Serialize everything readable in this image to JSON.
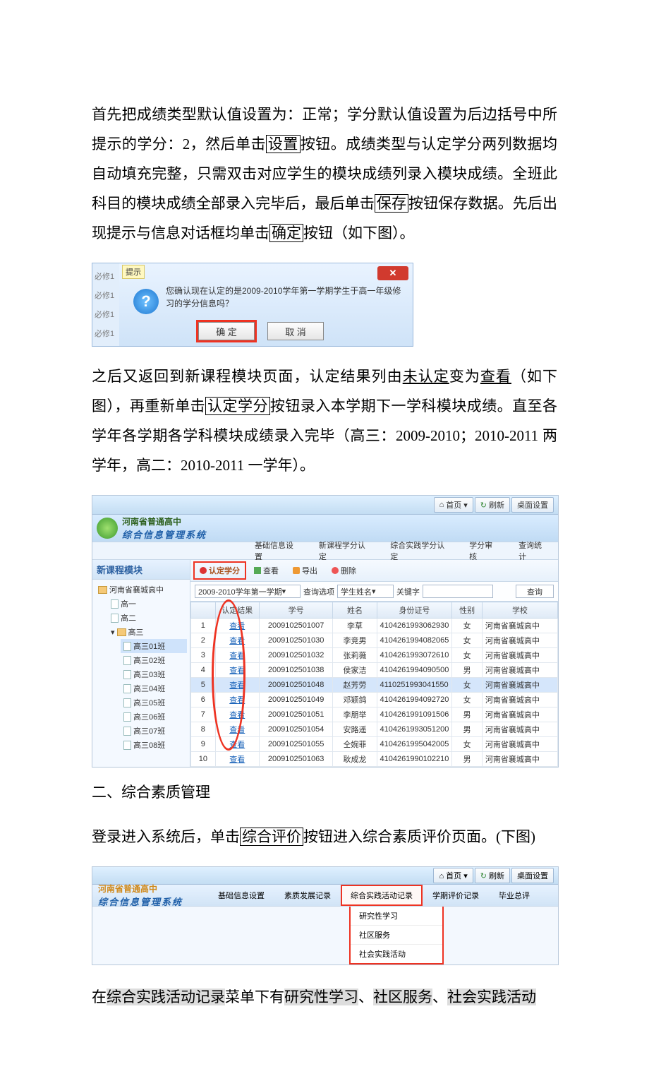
{
  "para1": {
    "a": "首先把成绩类型默认值设置为：正常；学分默认值设置为后边括号中所提示的学分：2，然后单击",
    "b": "设置",
    "c": "按钮。成绩类型与认定学分两列数据均自动填充完整，只需双击对应学生的模块成绩列录入模块成绩。全班此科目的模块成绩全部录入完毕后，最后单击",
    "d": "保存",
    "e": "按钮保存数据。先后出现提示与信息对话框均单击",
    "f": "确定",
    "g": "按钮（如下图）。"
  },
  "dialog": {
    "leftItems": [
      "必修1",
      "必修1",
      "必修1",
      "必修1"
    ],
    "tip": "提示",
    "close": "✕",
    "msg": "您确认现在认定的是2009-2010学年第一学期学生于高一年级修习的学分信息吗？",
    "ok": "确 定",
    "cancel": "取 消"
  },
  "para2": {
    "a": "之后又返回到新课程模块页面，认定结果列由",
    "b": "未认定",
    "c": "变为",
    "d": "查看",
    "e": "（如下图），再重新单击",
    "f": "认定学分",
    "g": "按钮录入本学期下一学科模块成绩。直至各学年各学期各学科模块成绩录入完毕（高三：2009-2010；2010-2011 两学年，高二：2010-2011 一学年）。"
  },
  "shot2": {
    "top": {
      "home": "首页",
      "refresh": "刷新",
      "desk": "桌面设置"
    },
    "brand": {
      "t1": "河南省普通高中",
      "t2": "综合信息管理系统"
    },
    "menu": [
      "基础信息设置",
      "新课程学分认定",
      "综合实践学分认定",
      "学分审核",
      "查询统计"
    ],
    "sideTitle": "新课程模块",
    "tree": {
      "root": "河南省襄城高中",
      "g1": "高一",
      "g2": "高二",
      "g3": "高三",
      "classes": [
        "高三01班",
        "高三02班",
        "高三03班",
        "高三04班",
        "高三05班",
        "高三06班",
        "高三07班",
        "高三08班"
      ]
    },
    "toolbar": {
      "rd": "认定学分",
      "view": "查看",
      "export": "导出",
      "del": "删除"
    },
    "filter": {
      "term": "2009-2010学年第一学期",
      "opt": "查询选项",
      "nameSel": "学生姓名",
      "kw": "关键字",
      "search": "查询"
    },
    "cols": [
      "",
      "认定结果",
      "学号",
      "姓名",
      "身份证号",
      "性别",
      "学校"
    ],
    "look": "查看",
    "rows": [
      {
        "n": "1",
        "id": "2009102501007",
        "name": "李草",
        "idno": "4104261993062930",
        "sex": "女",
        "sch": "河南省襄城高中"
      },
      {
        "n": "2",
        "id": "2009102501030",
        "name": "李竞男",
        "idno": "4104261994082065",
        "sex": "女",
        "sch": "河南省襄城高中"
      },
      {
        "n": "3",
        "id": "2009102501032",
        "name": "张莉薇",
        "idno": "4104261993072610",
        "sex": "女",
        "sch": "河南省襄城高中"
      },
      {
        "n": "4",
        "id": "2009102501038",
        "name": "侯家洁",
        "idno": "4104261994090500",
        "sex": "男",
        "sch": "河南省襄城高中"
      },
      {
        "n": "5",
        "id": "2009102501048",
        "name": "赵芳劳",
        "idno": "4110251993041550",
        "sex": "女",
        "sch": "河南省襄城高中"
      },
      {
        "n": "6",
        "id": "2009102501049",
        "name": "邓颖鸽",
        "idno": "4104261994092720",
        "sex": "女",
        "sch": "河南省襄城高中"
      },
      {
        "n": "7",
        "id": "2009102501051",
        "name": "李朋举",
        "idno": "4104261991091506",
        "sex": "男",
        "sch": "河南省襄城高中"
      },
      {
        "n": "8",
        "id": "2009102501054",
        "name": "安路遥",
        "idno": "4104261993051200",
        "sex": "男",
        "sch": "河南省襄城高中"
      },
      {
        "n": "9",
        "id": "2009102501055",
        "name": "仝婉菲",
        "idno": "4104261995042005",
        "sex": "女",
        "sch": "河南省襄城高中"
      },
      {
        "n": "10",
        "id": "2009102501063",
        "name": "耿成龙",
        "idno": "4104261990102210",
        "sex": "男",
        "sch": "河南省襄城高中"
      }
    ]
  },
  "heading2": "二、综合素质管理",
  "para3": {
    "a": "登录进入系统后，单击",
    "b": "综合评价",
    "c": "按钮进入综合素质评价页面。(下图)"
  },
  "shot3": {
    "top": {
      "home": "首页",
      "refresh": "刷新",
      "desk": "桌面设置"
    },
    "brand": {
      "a": "河南省普通高中",
      "b": "综合信息管理系统"
    },
    "menu": [
      "基础信息设置",
      "素质发展记录",
      "综合实践活动记录",
      "学期评价记录",
      "毕业总评"
    ],
    "drop": [
      "研究性学习",
      "社区服务",
      "社会实践活动"
    ]
  },
  "para4": {
    "a": "在",
    "b": "综合实践活动记录",
    "c": "菜单下有",
    "d": "研究性学习",
    "e": "、",
    "f": "社区服务",
    "g": "、",
    "h": "社会实践活动"
  }
}
